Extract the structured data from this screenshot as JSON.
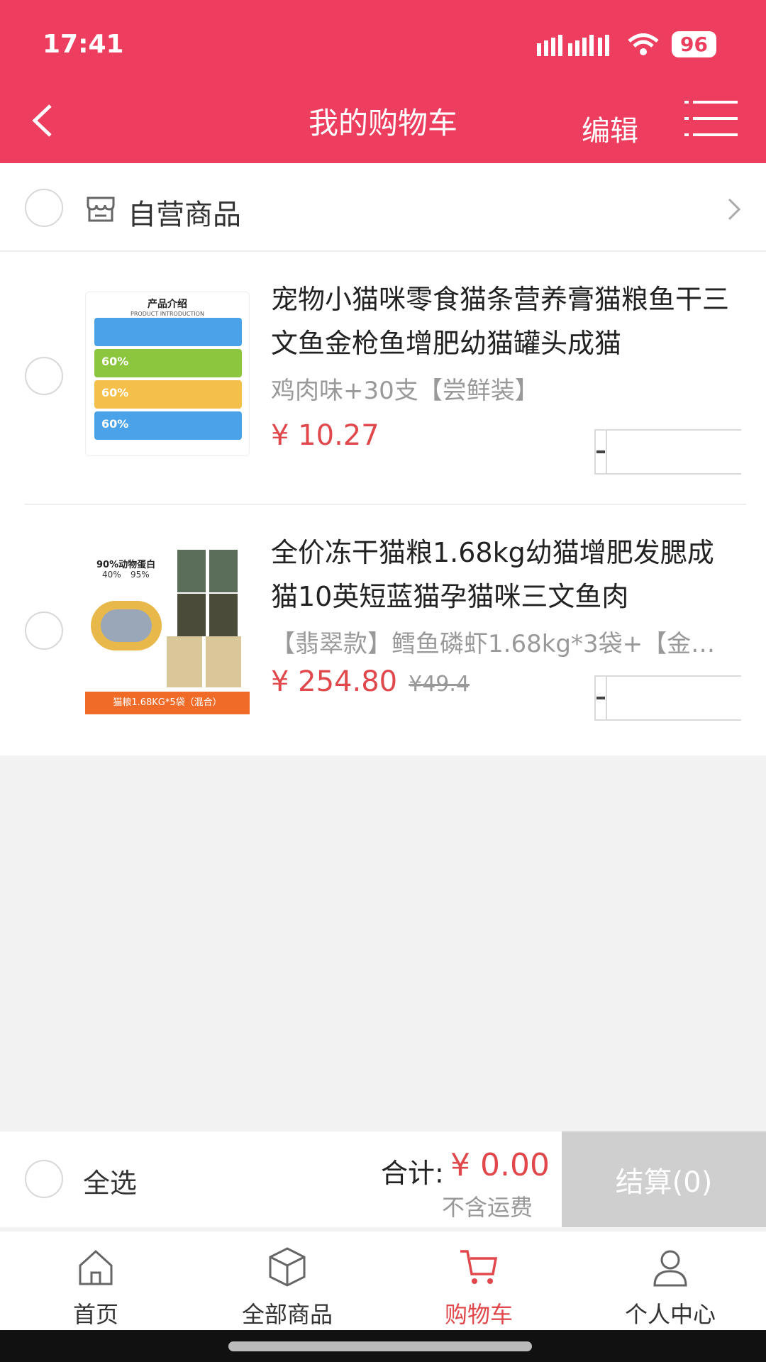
{
  "status_bar": {
    "time": "17:41",
    "battery": "96"
  },
  "header": {
    "title": "我的购物车",
    "edit_label": "编辑"
  },
  "shop": {
    "name": "自营商品"
  },
  "items": [
    {
      "title": "宠物小猫咪零食猫条营养膏猫粮鱼干三文鱼金枪鱼增肥幼猫罐头成猫",
      "spec": "鸡肉味+30支【尝鲜装】",
      "price": "¥ 10.27",
      "old_price": "",
      "image_text": {
        "heading": "产品介绍",
        "sub": "PRODUCT INTRODUCTION",
        "percent": "60%"
      }
    },
    {
      "title": "全价冻干猫粮1.68kg幼猫增肥发腮成猫10英短蓝猫孕猫咪三文鱼肉",
      "spec": "【翡翠款】鳕鱼磷虾1.68kg*3袋+【金…",
      "price": "¥ 254.80",
      "old_price": "¥49.4",
      "image_text": {
        "top": "90%动物蛋白",
        "p1": "40%",
        "p2": "95%",
        "banner": "猫粮1.68KG*5袋（混合）"
      }
    }
  ],
  "footer": {
    "select_all": "全选",
    "total_label": "合计:",
    "total_value": "¥ 0.00",
    "shipping_note": "不含运费",
    "checkout_label": "结算(0)"
  },
  "tabs": [
    {
      "label": "首页",
      "icon": "home-icon",
      "active": false
    },
    {
      "label": "全部商品",
      "icon": "box-icon",
      "active": false
    },
    {
      "label": "购物车",
      "icon": "cart-icon",
      "active": true
    },
    {
      "label": "个人中心",
      "icon": "person-icon",
      "active": false
    }
  ],
  "colors": {
    "brand": "#ee3e5f",
    "price": "#e0484c",
    "checkout_disabled": "#cfcfcf"
  }
}
